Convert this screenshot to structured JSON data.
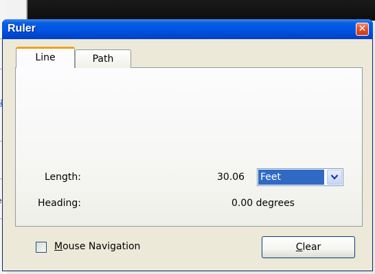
{
  "background": {
    "left_fragments": [
      "a",
      "el"
    ]
  },
  "dialog": {
    "title": "Ruler",
    "close_glyph": "✕",
    "tabs": [
      {
        "label": "Line",
        "active": true
      },
      {
        "label": "Path",
        "active": false
      }
    ],
    "length": {
      "label": "Length:",
      "value": "30.06",
      "unit_selected": "Feet"
    },
    "heading": {
      "label": "Heading:",
      "value": "0.00 degrees"
    },
    "mouse_navigation": {
      "label_first": "M",
      "label_rest": "ouse Navigation",
      "checked": false
    },
    "clear_button": {
      "label_first": "C",
      "label_rest": "lear"
    }
  },
  "icons": {
    "close": "close-icon",
    "dropdown": "chevron-down-icon"
  },
  "colors": {
    "titlebar": "#0055e5",
    "tab_accent": "#f0a020",
    "selection": "#316ac5",
    "dialog_bg": "#ece9d8"
  }
}
